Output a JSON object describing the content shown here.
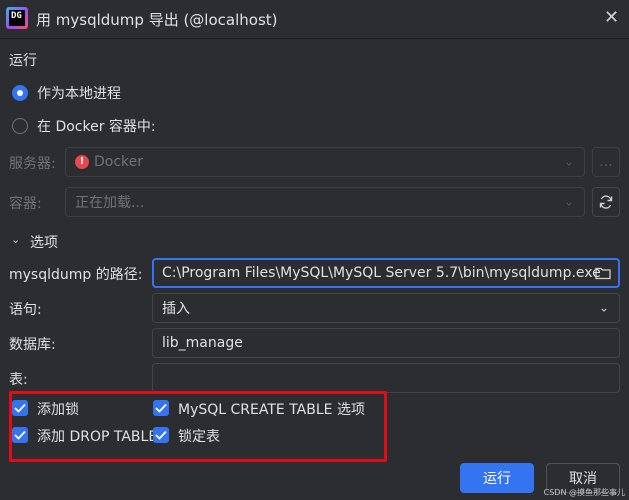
{
  "window": {
    "title": "用 mysqldump 导出 (@localhost)",
    "app_icon_text": "DG"
  },
  "run": {
    "section_label": "运行",
    "option_local": "作为本地进程",
    "option_docker": "在 Docker 容器中:",
    "server_label": "服务器:",
    "server_value": "Docker",
    "server_browse": "...",
    "container_label": "容器:",
    "container_value": "正在加载..."
  },
  "options": {
    "section_label": "选项",
    "path_label": "mysqldump 的路径:",
    "path_value": "C:\\Program Files\\MySQL\\MySQL Server 5.7\\bin\\mysqldump.exe",
    "statement_label": "语句:",
    "statement_value": "插入",
    "database_label": "数据库:",
    "database_value": "lib_manage",
    "tables_label": "表:",
    "tables_value": "",
    "checkboxes": {
      "add_locks": "添加锁",
      "mysql_create_table": "MySQL CREATE TABLE 选项",
      "add_drop_table": "添加 DROP TABLE",
      "lock_tables": "锁定表"
    }
  },
  "footer": {
    "run_button": "运行",
    "cancel_button": "取消"
  },
  "watermark": "CSDN @摸鱼那些事儿",
  "colors": {
    "accent": "#3574f0",
    "background": "#2b2d30",
    "highlight": "#e00d18",
    "error_icon": "#e5484d"
  }
}
